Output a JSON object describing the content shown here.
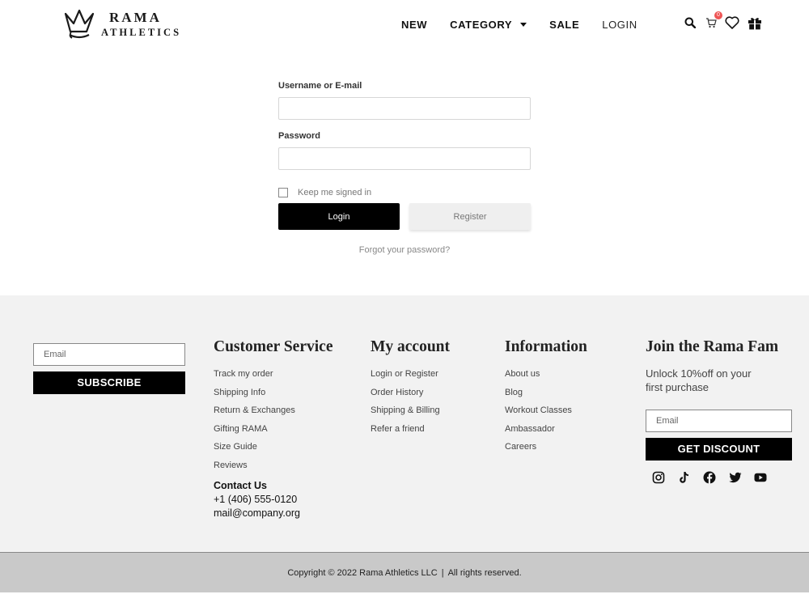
{
  "header": {
    "logo_name": "RAMA",
    "logo_sub": "ATHLETICS",
    "nav": {
      "new": "NEW",
      "category": "CATEGORY",
      "sale": "SALE",
      "login": "LOGIN"
    },
    "cart_count": "0",
    "icons": [
      "search-icon",
      "cart-icon",
      "heart-icon",
      "gift-icon"
    ]
  },
  "login_form": {
    "username_label": "Username or E-mail",
    "username_value": "",
    "password_label": "Password",
    "password_value": "",
    "remember_label": "Keep me signed in",
    "remember_checked": false,
    "login_button": "Login",
    "register_button": "Register",
    "forgot_link": "Forgot your password?"
  },
  "footer": {
    "subscribe": {
      "email_placeholder": "Email",
      "button": "SUBSCRIBE"
    },
    "customer_service": {
      "title": "Customer Service",
      "links": [
        "Track my order",
        "Shipping Info",
        "Return & Exchanges",
        "Gifting RAMA",
        "Size Guide",
        "Reviews"
      ],
      "contact_title": "Contact Us",
      "phone": "+1 (406) 555-0120",
      "email": "mail@company.org"
    },
    "my_account": {
      "title": "My account",
      "links": [
        "Login or Register",
        "Order History",
        "Shipping & Billing",
        "Refer a friend"
      ]
    },
    "information": {
      "title": "Information",
      "links": [
        "About us",
        "Blog",
        "Workout Classes",
        "Ambassador",
        "Careers"
      ]
    },
    "join": {
      "title": "Join the Rama Fam",
      "description": "Unlock 10%off on your first purchase",
      "email_placeholder": "Email",
      "button": "GET DISCOUNT",
      "social_icons": [
        "instagram-icon",
        "tiktok-icon",
        "facebook-icon",
        "twitter-icon",
        "youtube-icon"
      ]
    },
    "copyright": "Copyright © 2022 Rama Athletics LLC",
    "separator": "|",
    "rights": "All rights reserved."
  },
  "colors": {
    "footer_bg": "#f2f2f2",
    "bottom_bar_bg": "#c9c9c9",
    "primary_button": "#000000",
    "secondary_button": "#efefef",
    "badge": "#e55555"
  }
}
